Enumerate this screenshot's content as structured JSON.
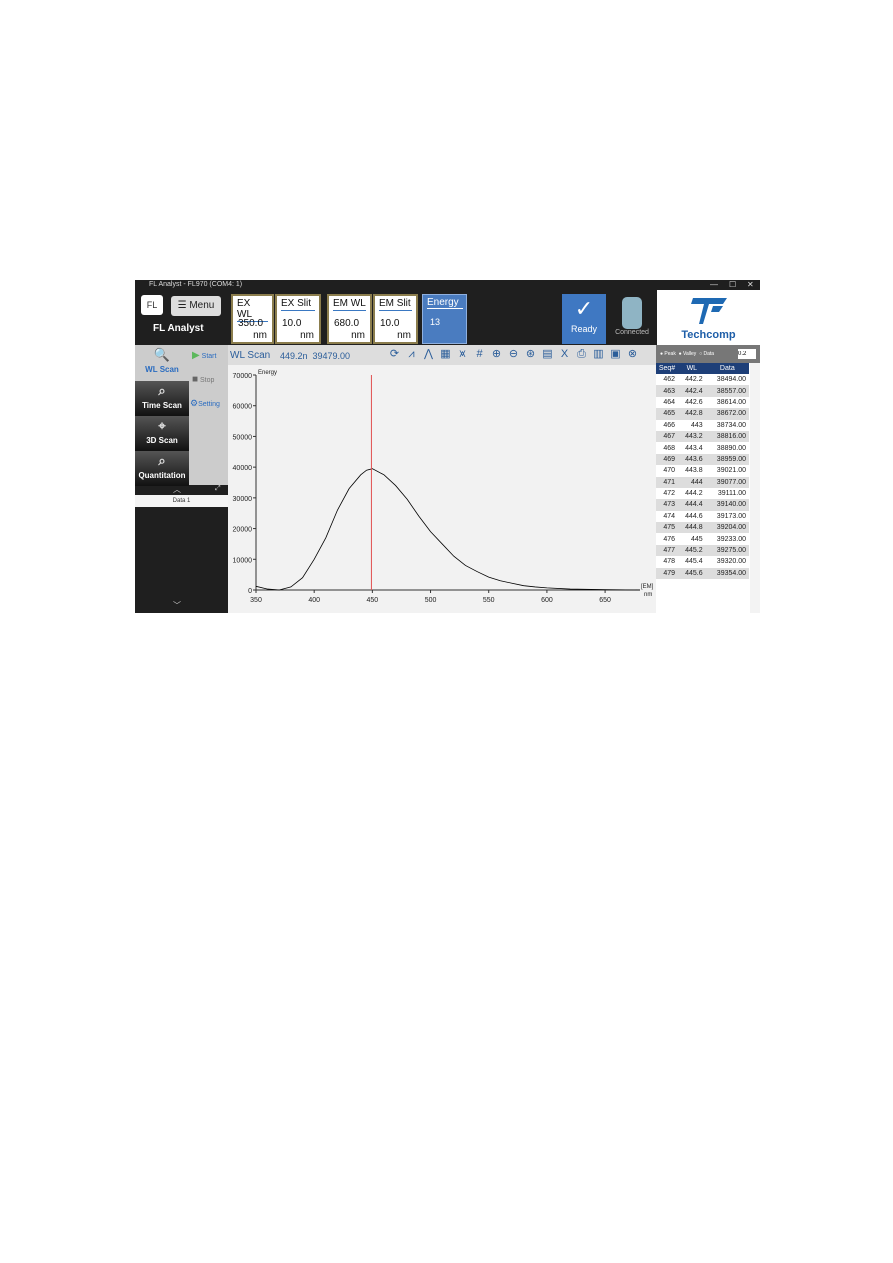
{
  "window": {
    "title": "FL Analyst - FL970 (COM4: 1)",
    "controls": [
      "—",
      "☐",
      "✕"
    ]
  },
  "header": {
    "logo": "FL",
    "menu_label": "☰ Menu",
    "app_name": "FL Analyst",
    "params": [
      {
        "label": "EX WL",
        "value": "350.0",
        "unit": "nm"
      },
      {
        "label": "EX Slit",
        "value": "10.0",
        "unit": "nm"
      },
      {
        "label": "EM WL",
        "value": "680.0",
        "unit": "nm"
      },
      {
        "label": "EM Slit",
        "value": "10.0",
        "unit": "nm"
      }
    ],
    "energy": {
      "label": "Energy",
      "value": "13"
    },
    "ready_label": "Ready",
    "connected_label": "Connected",
    "brand": "Techcomp",
    "accent": "#3f78c2"
  },
  "nav": {
    "items": [
      {
        "label": "WL Scan",
        "icon": "magnifier-icon"
      },
      {
        "label": "Time Scan",
        "icon": "time-scan-icon"
      },
      {
        "label": "3D Scan",
        "icon": "3d-scan-icon"
      },
      {
        "label": "Quantitation",
        "icon": "quantitation-icon"
      }
    ],
    "controls": {
      "start": "Start",
      "stop": "Stop",
      "setting": "Setting"
    },
    "data_tab": "Data 1"
  },
  "toolbar": {
    "mode": "WL Scan",
    "cursor_readout": "449.2n  39479.00",
    "tools": [
      "refresh-icon",
      "peak-icon",
      "peak-single-icon",
      "grid-view-icon",
      "bar-peak-icon",
      "grid-icon",
      "zoom-in-icon",
      "zoom-out-icon",
      "zoom-fit-icon",
      "table-icon",
      "excel-icon",
      "print-icon",
      "sheet-icon",
      "save-icon",
      "close-icon"
    ]
  },
  "side": {
    "options": [
      "Peak",
      "Valley",
      "Data"
    ],
    "threshold": "0.2",
    "columns": [
      "Seq#",
      "WL",
      "Data"
    ],
    "rows": [
      [
        "462",
        "442.2",
        "38494.00"
      ],
      [
        "463",
        "442.4",
        "38557.00"
      ],
      [
        "464",
        "442.6",
        "38614.00"
      ],
      [
        "465",
        "442.8",
        "38672.00"
      ],
      [
        "466",
        "443",
        "38734.00"
      ],
      [
        "467",
        "443.2",
        "38816.00"
      ],
      [
        "468",
        "443.4",
        "38890.00"
      ],
      [
        "469",
        "443.6",
        "38959.00"
      ],
      [
        "470",
        "443.8",
        "39021.00"
      ],
      [
        "471",
        "444",
        "39077.00"
      ],
      [
        "472",
        "444.2",
        "39111.00"
      ],
      [
        "473",
        "444.4",
        "39140.00"
      ],
      [
        "474",
        "444.6",
        "39173.00"
      ],
      [
        "475",
        "444.8",
        "39204.00"
      ],
      [
        "476",
        "445",
        "39233.00"
      ],
      [
        "477",
        "445.2",
        "39275.00"
      ],
      [
        "478",
        "445.4",
        "39320.00"
      ],
      [
        "479",
        "445.6",
        "39354.00"
      ]
    ]
  },
  "chart_data": {
    "type": "line",
    "ylabel": "Energy",
    "xlabel": "[EM]",
    "xunit": "nm",
    "xlim": [
      350,
      680
    ],
    "ylim": [
      0,
      70000
    ],
    "xticks": [
      350,
      400,
      450,
      500,
      550,
      600,
      650
    ],
    "yticks": [
      0,
      10000,
      20000,
      30000,
      40000,
      50000,
      60000,
      70000
    ],
    "cursor_x": 449.2,
    "line_color": "#000000",
    "cursor_color": "#e05050",
    "x": [
      350,
      360,
      370,
      380,
      390,
      400,
      410,
      420,
      430,
      440,
      445,
      450,
      460,
      470,
      480,
      490,
      500,
      510,
      520,
      530,
      540,
      550,
      560,
      570,
      580,
      590,
      600,
      620,
      650,
      680
    ],
    "y": [
      1200,
      300,
      0,
      1000,
      4000,
      10000,
      17000,
      26000,
      33000,
      37500,
      39000,
      39500,
      37500,
      34000,
      29500,
      24000,
      19000,
      15000,
      11000,
      8000,
      6000,
      4200,
      3000,
      2200,
      1400,
      1000,
      700,
      300,
      100,
      0
    ]
  }
}
